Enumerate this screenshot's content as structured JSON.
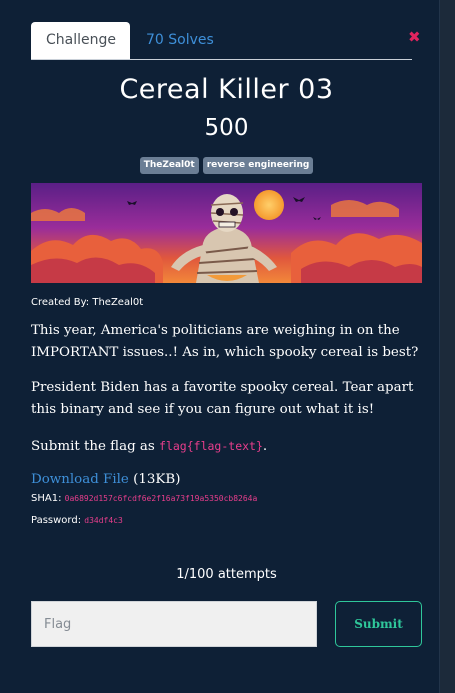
{
  "tabs": [
    {
      "label": "Challenge",
      "active": true
    },
    {
      "label": "70 Solves",
      "active": false
    }
  ],
  "close_icon": "close-icon",
  "challenge": {
    "title": "Cereal Killer 03",
    "points": "500",
    "tags": [
      "TheZeal0t",
      "reverse engineering"
    ],
    "banner_image": "mummy-skeleton-illustration",
    "created_by": "Created By: TheZeal0t",
    "description_1": "This year, America's politicians are weighing in on the IMPORTANT issues..! As in, which spooky cereal is best?",
    "description_2": "President Biden has a favorite spooky cereal. Tear apart this binary and see if you can figure out what it is!",
    "description_3_prefix": "Submit the flag as ",
    "flag_format": "flag{flag-text}",
    "description_3_suffix": ".",
    "download_label": "Download File",
    "file_size": "(13KB)",
    "sha1_label": "SHA1:",
    "sha1_value": "0a6892d157c6fcdf6e2f16a73f19a5350cb8264a",
    "password_label": "Password:",
    "password_value": "d34df4c3"
  },
  "attempts": "1/100 attempts",
  "form": {
    "flag_placeholder": "Flag",
    "submit_label": "Submit"
  },
  "colors": {
    "modal_bg": "#0e2036",
    "link": "#3e8fd8",
    "code": "#e83e8c",
    "submit_accent": "#2fc79a",
    "close": "#e0245e"
  }
}
